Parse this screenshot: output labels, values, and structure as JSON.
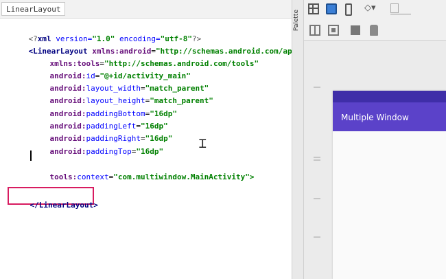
{
  "editor": {
    "breadcrumb": "LinearLayout",
    "code": {
      "line1": {
        "a": "<?",
        "b": "xml",
        "c": " version=",
        "d": "\"1.0\"",
        "e": " encoding=",
        "f": "\"utf-8\"",
        "g": "?>"
      },
      "line2": {
        "tag": "<LinearLayout",
        "ns": " xmlns:",
        "attr": "android",
        "eq": "=",
        "val": "\"http://schemas.android.com/apk/res/android\""
      },
      "line3": {
        "ns": "xmlns:",
        "attr": "tools",
        "eq": "=",
        "val": "\"http://schemas.android.com/tools\""
      },
      "line4": {
        "ns": "android:",
        "attr": "id",
        "eq": "=",
        "val": "\"@+id/activity_main\""
      },
      "line5": {
        "ns": "android:",
        "attr": "layout_width",
        "eq": "=",
        "val": "\"match_parent\""
      },
      "line6": {
        "ns": "android:",
        "attr": "layout_height",
        "eq": "=",
        "val": "\"match_parent\""
      },
      "line7": {
        "ns": "android:",
        "attr": "paddingBottom",
        "eq": "=",
        "val": "\"16dp\""
      },
      "line8": {
        "ns": "android:",
        "attr": "paddingLeft",
        "eq": "=",
        "val": "\"16dp\""
      },
      "line9": {
        "ns": "android:",
        "attr": "paddingRight",
        "eq": "=",
        "val": "\"16dp\""
      },
      "line10": {
        "ns": "android:",
        "attr": "paddingTop",
        "eq": "=",
        "val": "\"16dp\""
      },
      "line11": {
        "ns": "tools:",
        "attr": "context",
        "eq": "=",
        "val": "\"com.multiwindow.MainActivity\">"
      },
      "close": "</LinearLayout>"
    }
  },
  "palette_label": "Palette",
  "preview": {
    "app_title": "Multiple Window",
    "accent_color": "#5b42c9",
    "status_color": "#3f2ea8"
  },
  "toolbar_icons": [
    "layout-icon",
    "blueprint-icon",
    "orientation-icon",
    "theme-icon",
    "device-icon",
    "grid-icon",
    "align-icon",
    "zoom-icon",
    "pan-icon"
  ]
}
